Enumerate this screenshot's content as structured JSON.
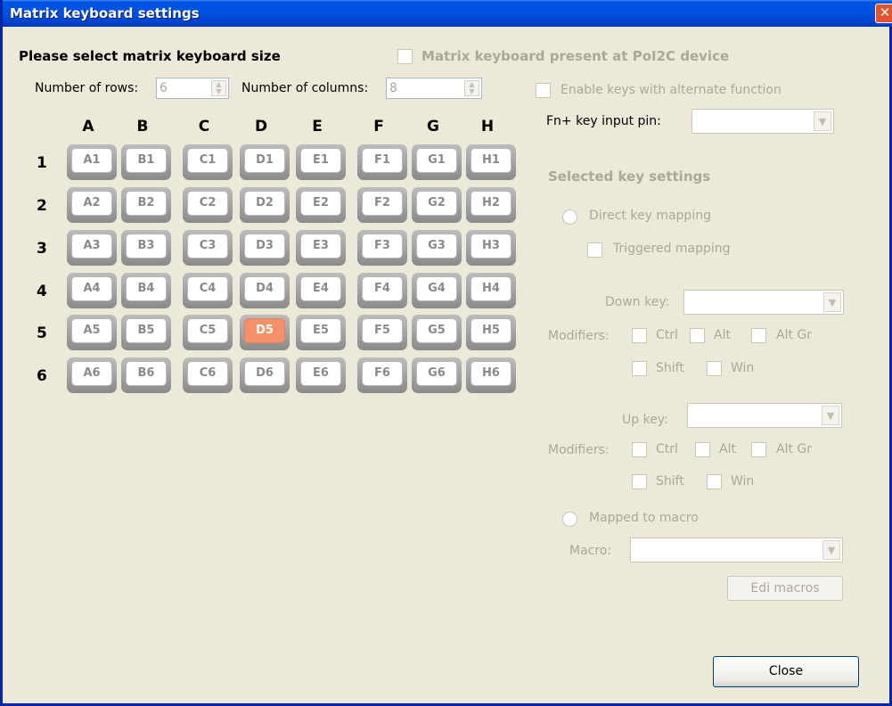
{
  "window": {
    "title": "Matrix keyboard settings",
    "close_glyph": "✕"
  },
  "size_section": {
    "heading": "Please select matrix keyboard size",
    "rows_label": "Number of rows:",
    "rows_value": "6",
    "cols_label": "Number of columns:",
    "cols_value": "8"
  },
  "present_checkbox_label": "Matrix keyboard present at PoI2C device",
  "alt_function": {
    "enable_label": "Enable keys with alternate function",
    "fn_pin_label": "Fn+ key input pin:",
    "fn_pin_value": ""
  },
  "matrix": {
    "columns": [
      "A",
      "B",
      "C",
      "D",
      "E",
      "F",
      "G",
      "H"
    ],
    "rows": [
      "1",
      "2",
      "3",
      "4",
      "5",
      "6"
    ],
    "selected_key": "D5"
  },
  "key_settings": {
    "heading": "Selected key settings",
    "direct_mapping_label": "Direct key mapping",
    "triggered_mapping_label": "Triggered mapping",
    "down_key_label": "Down key:",
    "down_key_value": "",
    "up_key_label": "Up key:",
    "up_key_value": "",
    "modifiers_label": "Modifiers:",
    "mod_ctrl": "Ctrl",
    "mod_alt": "Alt",
    "mod_altgr": "Alt Gr",
    "mod_shift": "Shift",
    "mod_win": "Win",
    "mapped_macro_label": "Mapped to macro",
    "macro_label": "Macro:",
    "macro_value": "",
    "edit_macros_label": "Edi macros"
  },
  "footer": {
    "close_label": "Close"
  },
  "colors": {
    "title_bar": "#0054e3",
    "selected_key": "#f4916a",
    "disabled_text": "#aca899"
  }
}
